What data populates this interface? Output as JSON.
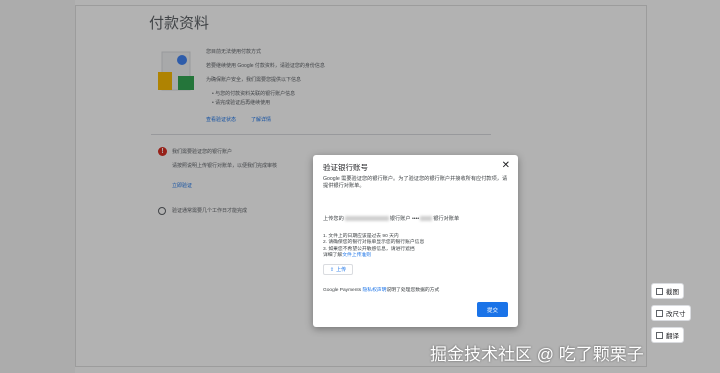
{
  "page": {
    "title": "付款资料",
    "intro_heading": "您目前无法使用付款方式",
    "intro_lines": [
      "若要继续使用 Google 付款资料，请验证您的身份信息",
      "为确保账户安全，我们需要您提供以下信息"
    ],
    "bullets": [
      "与您的付款资料关联的银行账户信息",
      "请完成验证后再继续使用"
    ],
    "links": [
      "查看验证状态",
      "了解详情"
    ],
    "notice_text": "我们需要验证您的银行账户",
    "notice_sub": "请按照说明上传银行对账单，以便我们完成审核",
    "notice_link": "立即验证",
    "pending_text": "验证通常需要几个工作日才能完成"
  },
  "dialog": {
    "title": "验证银行账号",
    "close_label": "✕",
    "description": "Google 需要验证您的银行账户。为了验证您的银行账户并接收所有应付款项，请提供银行对账单。",
    "upload_prefix": "上传您的",
    "upload_middle": "银行账户 ••••",
    "upload_suffix": "银行对账单",
    "list_items": [
      "1. 文件上的日期应该是过去 90 天内",
      "2. 请确保您的银行对账单显示您的银行账户信息",
      "3. 如果您不希望公开敏感信息，请进行遮挡"
    ],
    "learn_more_prefix": "详细了解",
    "learn_more_link": "文件上传准则",
    "upload_button": "上传",
    "footer_prefix": "Google Payments",
    "footer_link": "隐私权声明",
    "footer_suffix": "说明了处理您数据的方式",
    "submit_button": "提交"
  },
  "float_buttons": [
    "截图",
    "改尺寸",
    "翻译"
  ],
  "watermark": "掘金技术社区 @ 吃了颗栗子"
}
